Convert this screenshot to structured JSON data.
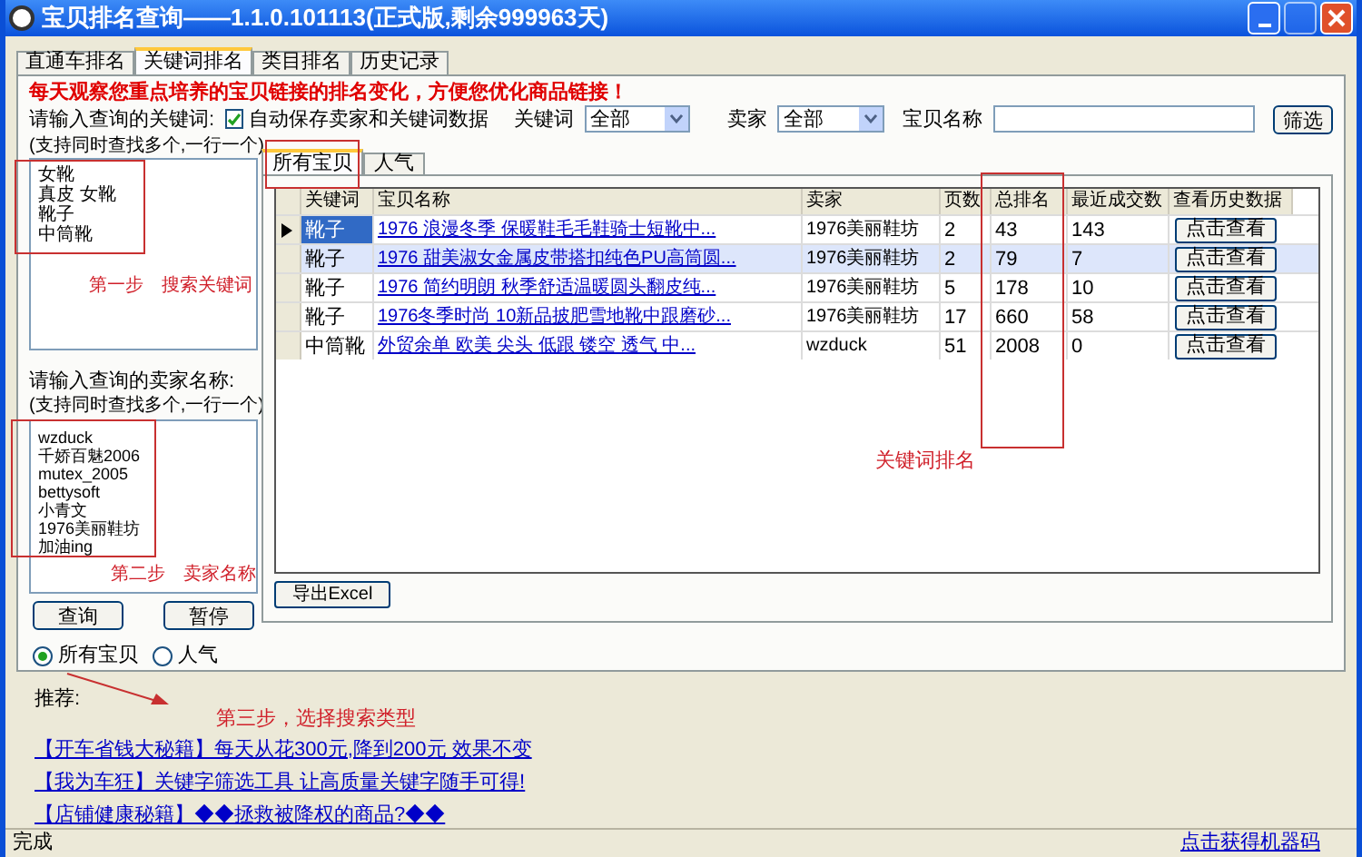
{
  "window": {
    "title": "宝贝排名查询——1.1.0.101113(正式版,剩余999963天)"
  },
  "tabs": [
    {
      "label": "直通车排名",
      "selected": false
    },
    {
      "label": "关键词排名",
      "selected": true
    },
    {
      "label": "类目排名",
      "selected": false
    },
    {
      "label": "历史记录",
      "selected": false
    }
  ],
  "notice": "每天观察您重点培养的宝贝链接的排名变化，方便您优化商品链接！",
  "filter": {
    "keyword_prompt": "请输入查询的关键词:",
    "autosave": {
      "label": "自动保存卖家和关键词数据",
      "checked": true
    },
    "keyword_label": "关键词",
    "keyword_value": "全部",
    "seller_label": "卖家",
    "seller_value": "全部",
    "name_label": "宝贝名称",
    "filter_button": "筛选"
  },
  "keyword_hint": "(支持同时查找多个,一行一个)",
  "keywords": [
    "女靴",
    "真皮 女靴",
    "靴子",
    "中筒靴"
  ],
  "step1": "第一步　搜索关键词",
  "seller_prompt": "请输入查询的卖家名称:",
  "seller_hint": "(支持同时查找多个,一行一个)",
  "sellers": [
    "wzduck",
    "千娇百魅2006",
    "mutex_2005",
    "bettysoft",
    "小青文",
    "1976美丽鞋坊",
    "加油ing"
  ],
  "step2": "第二步　卖家名称",
  "buttons": [
    "查询",
    "暂停"
  ],
  "radios": [
    {
      "label": "所有宝贝",
      "selected": true
    },
    {
      "label": "人气",
      "selected": false
    }
  ],
  "result_tabs": [
    {
      "label": "所有宝贝",
      "selected": true
    },
    {
      "label": "人气",
      "selected": false
    }
  ],
  "table": {
    "columns": [
      "关键词",
      "宝贝名称",
      "卖家",
      "页数",
      "总排名",
      "最近成交数",
      "查看历史数据"
    ],
    "rows": [
      {
        "selected": true,
        "cells": [
          "靴子",
          "1976 浪漫冬季 保暖鞋毛毛鞋骑士短靴中...",
          "1976美丽鞋坊",
          "2",
          "43",
          "143"
        ],
        "action": "点击查看"
      },
      {
        "selected": false,
        "cells": [
          "靴子",
          "1976 甜美淑女金属皮带搭扣纯色PU高筒圆...",
          "1976美丽鞋坊",
          "2",
          "79",
          "7"
        ],
        "action": "点击查看"
      },
      {
        "selected": false,
        "cells": [
          "靴子",
          "1976 简约明朗 秋季舒适温暖圆头翻皮纯...",
          "1976美丽鞋坊",
          "5",
          "178",
          "10"
        ],
        "action": "点击查看"
      },
      {
        "selected": false,
        "cells": [
          "靴子",
          "1976冬季时尚 10新品披肥雪地靴中跟磨砂...",
          "1976美丽鞋坊",
          "17",
          "660",
          "58"
        ],
        "action": "点击查看"
      },
      {
        "selected": false,
        "cells": [
          "中筒靴",
          "外贸余单 欧美 尖头 低跟 镂空 透气 中...",
          "wzduck",
          "51",
          "2008",
          "0"
        ],
        "action": "点击查看"
      }
    ]
  },
  "table_note": "关键词排名",
  "export_button": "导出Excel",
  "recommend_label": "推荐:",
  "step3": "第三步，选择搜索类型",
  "links": [
    "【开车省钱大秘籍】每天从花300元,降到200元 效果不变",
    "【我为车狂】关键字筛选工具 让高质量关键字随手可得!",
    "【店铺健康秘籍】◆◆拯救被降权的商品?◆◆"
  ],
  "status_bar": {
    "text": "完成",
    "link": "点击获得机器码"
  }
}
